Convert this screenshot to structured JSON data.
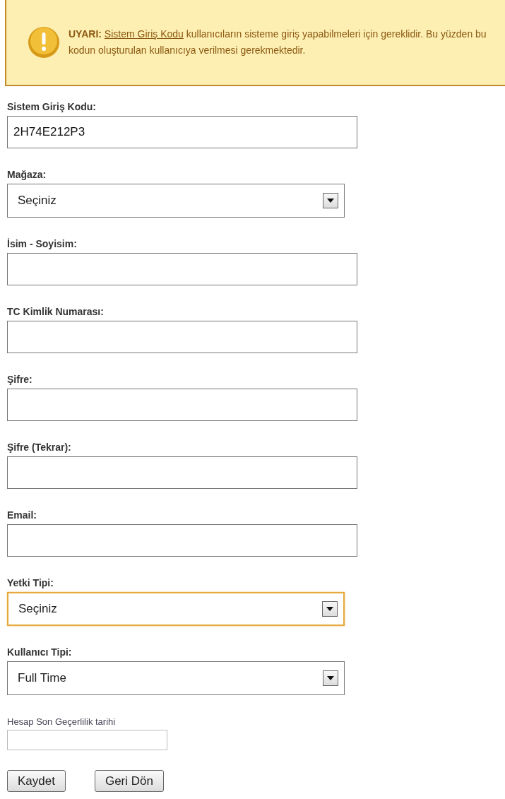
{
  "warning": {
    "label": "UYARI:",
    "link": "Sistem Giriş Kodu",
    "text": "kullanıcıların sisteme giriş yapabilmeleri için gereklidir. Bu yüzden bu kodun oluşturulan kullanıcıya verilmesi gerekmektedir."
  },
  "fields": [
    {
      "kind": "text",
      "label": "Sistem Giriş Kodu:",
      "value": "2H74E212P3"
    },
    {
      "kind": "select",
      "label": "Mağaza:",
      "value": "Seçiniz",
      "focused": false
    },
    {
      "kind": "text",
      "label": "İsim - Soyisim:"
    },
    {
      "kind": "text",
      "label": "TC Kimlik Numarası:"
    },
    {
      "kind": "text",
      "label": "Şifre:"
    },
    {
      "kind": "text",
      "label": "Şifre (Tekrar):"
    },
    {
      "kind": "text",
      "label": "Email:"
    },
    {
      "kind": "select",
      "label": "Yetki Tipi:",
      "value": "Seçiniz",
      "focused": true
    },
    {
      "kind": "select",
      "label": "Kullanıcı Tipi:",
      "value": "Full Time",
      "focused": false
    },
    {
      "kind": "date",
      "label": "Hesap Son Geçerlilik tarihi"
    }
  ],
  "buttons": [
    "Kaydet",
    "Geri Dön"
  ]
}
